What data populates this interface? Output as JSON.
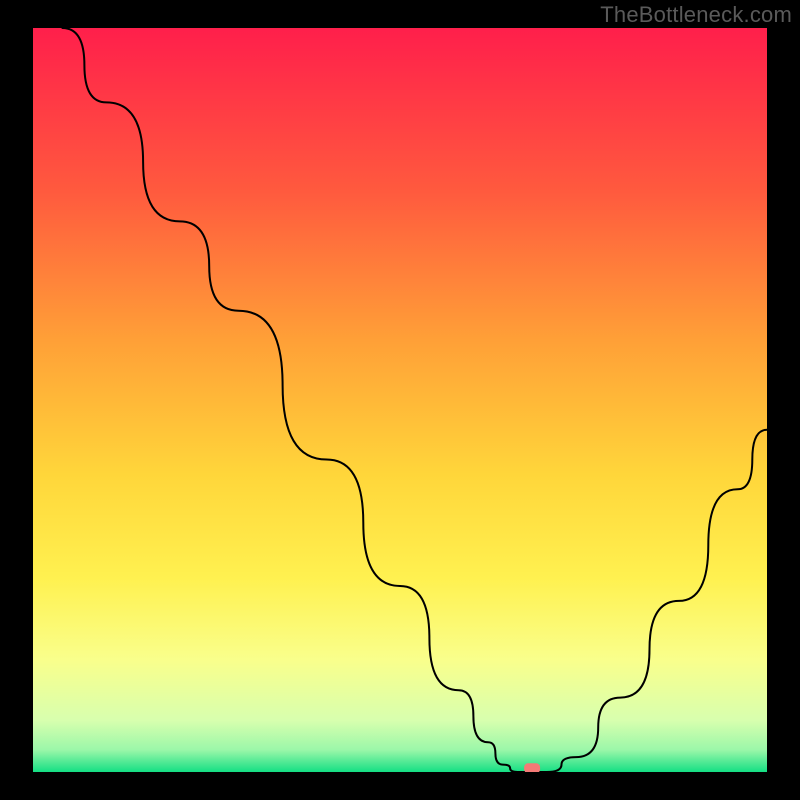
{
  "watermark": "TheBottleneck.com",
  "chart_data": {
    "type": "line",
    "title": "",
    "xlabel": "",
    "ylabel": "",
    "xlim": [
      0,
      100
    ],
    "ylim": [
      0,
      100
    ],
    "grid": false,
    "series": [
      {
        "name": "bottleneck-curve",
        "x": [
          4,
          10,
          20,
          28,
          40,
          50,
          58,
          62,
          64,
          66,
          70,
          74,
          80,
          88,
          96,
          100
        ],
        "y": [
          100,
          90,
          74,
          62,
          42,
          25,
          11,
          4,
          1,
          0,
          0,
          2,
          10,
          23,
          38,
          46
        ]
      }
    ],
    "annotations": [
      {
        "name": "optimal-point",
        "x": 68,
        "y": 0.5
      }
    ],
    "background_gradient": [
      "#ff1f4b",
      "#ff6a3c",
      "#ffb236",
      "#ffe13a",
      "#fff85e",
      "#f2ffa0",
      "#c8ffb0",
      "#1de38a"
    ]
  }
}
